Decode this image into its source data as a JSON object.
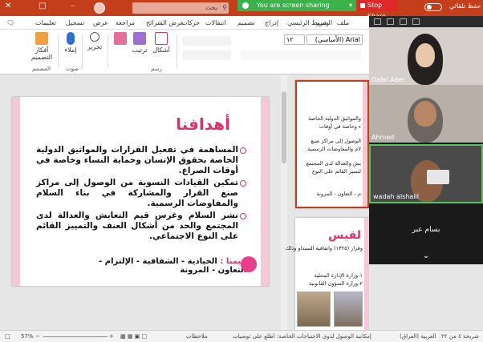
{
  "titlebar": {
    "search_text": "بحث",
    "sharing_status": "You are screen sharing",
    "stop_share": "Stop Share",
    "autosave_label": "حفظ تلقائي",
    "minimize": "–",
    "maximize": "□",
    "close": "✕"
  },
  "tabs": [
    "ملف",
    "الشريط الرئيسي",
    "إدراج",
    "تصميم",
    "انتقالات",
    "حركات",
    "عرض الشرائح",
    "مراجعة",
    "عرض",
    "تسجيل",
    "تعليمات",
    "رسم"
  ],
  "ribbon": {
    "font_name": "Arial (الأساسي)",
    "font_size": "١٢",
    "shapes_label": "أشكال",
    "arrange_label": "ترتيب",
    "quick_styles_label": "أنماط سريعة",
    "edit_label": "تحرير",
    "dictate_label": "إملاء",
    "designer_label": "أفكار التصميم",
    "group_drawing": "رسم",
    "group_voice": "صوت",
    "group_designer": "المصمم"
  },
  "slide": {
    "title": "أهدافنا",
    "bullets": [
      "المساهمة في تفعيل القرارات والمواثيق الدولية الخاصة بحقوق الإنسان وحماية النساء وخاصة في أوقات الصراع.",
      "تمكين القيادات النسوية من الوصول إلى مراكز صنع القرار والمشاركة في بناء السلام والمفاوضات الرسمية.",
      "نشر السلام وغرس قيم التعايش والعدالة لدى المجتمع والحد من أشكال العنف والتمييز القائم على النوع الاجتماعي."
    ],
    "values_label": "قيمنا :",
    "values_text": "الحيادية - الشفافية - الإلتزام - التعاون - المرونة"
  },
  "thumb1": {
    "lines": [
      "والمواثيق الدولية الخاصة",
      "ء وخاصة في أوقات",
      "الوصول إلى مراكز صنع",
      "لام والمفاوضات الرسمية.",
      "يش والعدالة لدى المجتمع",
      "لتمييز القائم على النوع"
    ],
    "values_line": "م - التعاون - المرونة"
  },
  "thumb2": {
    "title": "لقيس",
    "line1": "وقرار (١٣٢٥) واتفاقية السيداو وذلك",
    "item1": "١-وزارة الإدارة المحلية",
    "item2": "٢-وزارة الشؤون القانونية"
  },
  "participants": [
    {
      "name": "Dalal Adel"
    },
    {
      "name": "Ahmed"
    },
    {
      "name": "wadah alshaiil"
    }
  ],
  "inactive_participant": "بسام عبر",
  "panel_collapse": "⌄",
  "statusbar": {
    "slide_info": "شريحة ٤ من ٢٢",
    "language": "العربية (العراق)",
    "accessibility": "إمكانية الوصول لذوي الاحتياجات الخاصة: اطلع على توصيات",
    "notes": "ملاحظات",
    "zoom": "57%",
    "zoom_minus": "−",
    "zoom_plus": "+"
  },
  "colors": {
    "title_bar": "#c43e1c",
    "accent_pink": "#d6336c",
    "share_green": "#3bb24a",
    "stop_red": "#e02828"
  }
}
